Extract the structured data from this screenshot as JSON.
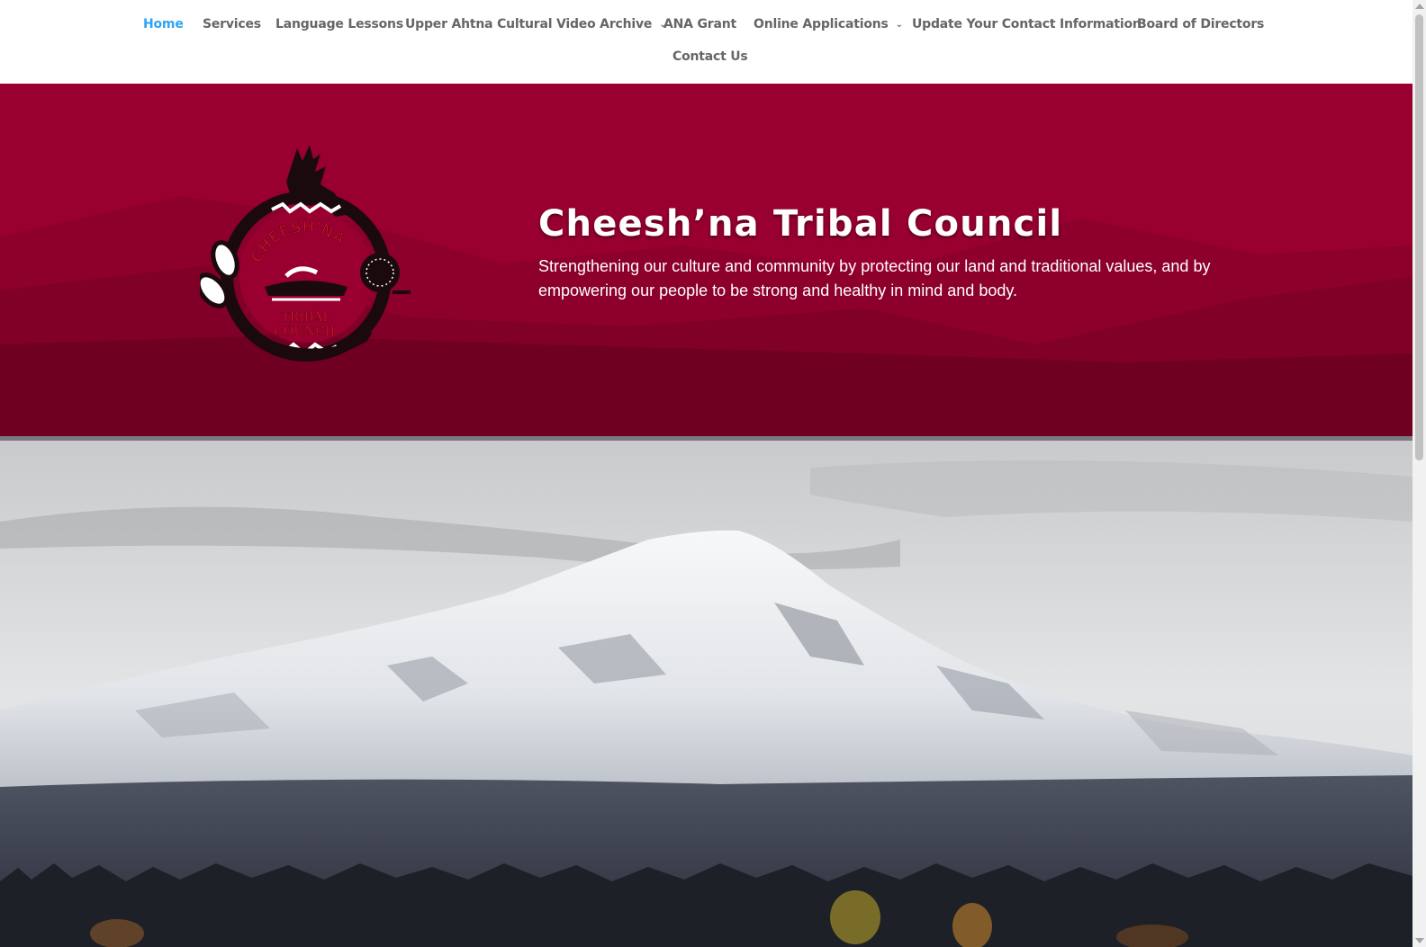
{
  "nav": {
    "items": [
      {
        "label": "Home",
        "active": true,
        "has_dropdown": false
      },
      {
        "label": "Services",
        "active": false,
        "has_dropdown": false
      },
      {
        "label": "Language Lessons",
        "active": false,
        "has_dropdown": false
      },
      {
        "label": "Upper Ahtna Cultural Video Archive",
        "active": false,
        "has_dropdown": true
      },
      {
        "label": "ANA Grant",
        "active": false,
        "has_dropdown": false
      },
      {
        "label": "Online Applications",
        "active": false,
        "has_dropdown": true
      },
      {
        "label": "Update Your Contact Information",
        "active": false,
        "has_dropdown": false
      },
      {
        "label": "Board of Directors",
        "active": false,
        "has_dropdown": false
      },
      {
        "label": "Contact Us",
        "active": false,
        "has_dropdown": false
      }
    ]
  },
  "hero": {
    "title": "Cheesh’na Tribal Council",
    "tagline": "Strengthening our culture and community by protecting our land and traditional values, and by empowering our people to be strong and healthy in mind and body.",
    "logo_text_top": "CHEESH'NA",
    "logo_text_bottom_1": "TRIBAL",
    "logo_text_bottom_2": "COUNCIL"
  },
  "colors": {
    "hero_bg": "#990030",
    "nav_active": "#2ea3f2",
    "nav_text": "#666666"
  },
  "icons": {
    "dropdown": "chevron-down-icon",
    "scroll_up": "scroll-up-arrow-icon",
    "scroll_down": "scroll-down-arrow-icon"
  }
}
